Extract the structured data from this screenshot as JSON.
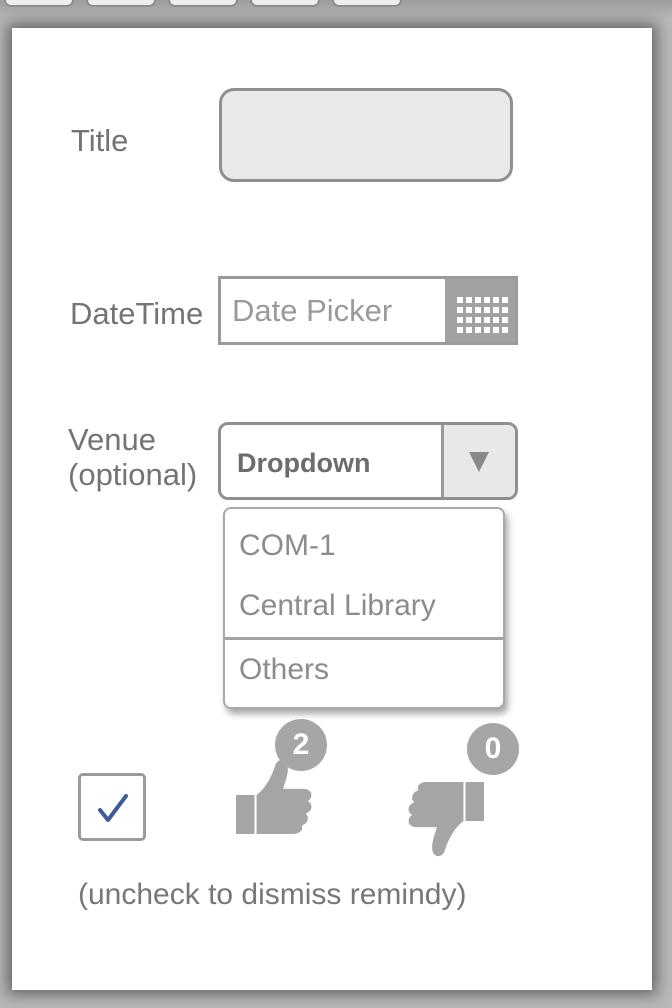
{
  "form": {
    "title_label": "Title",
    "title_value": "",
    "datetime_label": "DateTime",
    "date_placeholder": "Date Picker",
    "venue_label": "Venue\n(optional)",
    "venue_selected": "Dropdown",
    "venue_options": [
      "COM-1",
      "Central Library",
      "Others"
    ]
  },
  "reminder": {
    "checked": true,
    "check_glyph": "✓",
    "caption": "(uncheck to dismiss remindy)"
  },
  "votes": {
    "up_count": "2",
    "down_count": "0"
  },
  "icons": {
    "calendar": "calendar-icon",
    "dropdown": "chevron-down-icon",
    "up": "thumbs-up-icon",
    "down": "thumbs-down-icon"
  },
  "colors": {
    "panel": "#ffffff",
    "text": "#747474",
    "field_fill": "#e9e9e9",
    "badge": "#a6a6a6",
    "check": "#3f5b9a"
  }
}
